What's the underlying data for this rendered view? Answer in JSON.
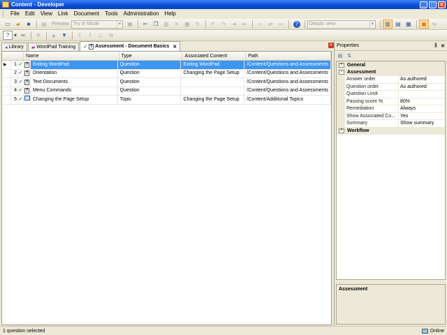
{
  "window": {
    "title": "Content - Developer"
  },
  "menu": [
    "File",
    "Edit",
    "View",
    "Link",
    "Document",
    "Tools",
    "Administration",
    "Help"
  ],
  "toolbar": {
    "preview_label": "Preview",
    "mode_combo": "Try It! Mode",
    "view_combo": "Details view"
  },
  "tabs": [
    {
      "label": "Library",
      "icon": "library-icon"
    },
    {
      "label": "WordPad Training",
      "icon": "outline-icon"
    },
    {
      "label": "Assessment - Document Basics",
      "icon": "assessment-icon",
      "active": true
    }
  ],
  "grid": {
    "columns": [
      "Name",
      "Type",
      "Associated Content",
      "Path"
    ],
    "rows": [
      {
        "num": "1",
        "name": "Exiting WordPad",
        "type": "Question",
        "assoc": "Exiting WordPad",
        "path": "/Content/Questions and Assessments",
        "selected": true,
        "pointer": "▶"
      },
      {
        "num": "2",
        "name": "Orientation",
        "type": "Question",
        "assoc": "Changing the Page Setup",
        "path": "/Content/Questions and Assessments",
        "pointer": ""
      },
      {
        "num": "3",
        "name": "Text Documents",
        "type": "Question",
        "assoc": "",
        "path": "/Content/Questions and Assessments",
        "pointer": ""
      },
      {
        "num": "4",
        "name": "Menu Commands",
        "type": "Question",
        "assoc": "",
        "path": "/Content/Questions and Assessments",
        "pointer": ""
      },
      {
        "num": "5",
        "name": "Changing the Page Setup",
        "type": "Topic",
        "assoc": "Changing the Page Setup",
        "path": "/Content/Additional Topics",
        "pointer": ""
      }
    ]
  },
  "properties": {
    "title": "Properties",
    "categories": {
      "general": "General",
      "assessment": "Assessment",
      "workflow": "Workflow"
    },
    "items": [
      {
        "key": "Answer order",
        "value": "As authored"
      },
      {
        "key": "Question order",
        "value": "As authored"
      },
      {
        "key": "Question Limit",
        "value": ""
      },
      {
        "key": "Passing score %",
        "value": "80%"
      },
      {
        "key": "Remediation",
        "value": "Always"
      },
      {
        "key": "Show Associated Co...",
        "value": "Yes"
      },
      {
        "key": "Summary",
        "value": "Show summary"
      }
    ],
    "description_title": "Assessment"
  },
  "status": {
    "left": "1 question selected",
    "right": "Online"
  }
}
